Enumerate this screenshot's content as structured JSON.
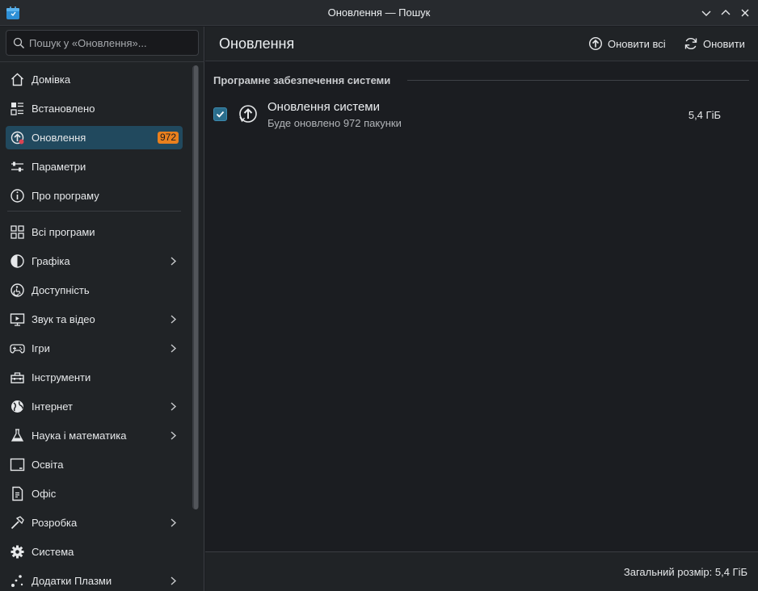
{
  "window": {
    "title": "Оновлення — Пошук",
    "controls": [
      "minimize-icon",
      "maximize-icon",
      "close-icon"
    ]
  },
  "search": {
    "placeholder": "Пошук у «Оновлення»..."
  },
  "sidebar": {
    "top_items": [
      {
        "label": "Домівка",
        "icon": "home-icon"
      },
      {
        "label": "Встановлено",
        "icon": "installed-icon"
      },
      {
        "label": "Оновлення",
        "icon": "updates-icon",
        "badge": "972",
        "active": true
      },
      {
        "label": "Параметри",
        "icon": "settings-sliders-icon"
      },
      {
        "label": "Про програму",
        "icon": "info-icon"
      }
    ],
    "categories": [
      {
        "label": "Всі програми",
        "icon": "grid-icon",
        "has_children": false
      },
      {
        "label": "Графіка",
        "icon": "graphics-icon",
        "has_children": true
      },
      {
        "label": "Доступність",
        "icon": "accessibility-icon",
        "has_children": false
      },
      {
        "label": "Звук та відео",
        "icon": "multimedia-icon",
        "has_children": true
      },
      {
        "label": "Ігри",
        "icon": "gamepad-icon",
        "has_children": true
      },
      {
        "label": "Інструменти",
        "icon": "toolbox-icon",
        "has_children": false
      },
      {
        "label": "Інтернет",
        "icon": "globe-icon",
        "has_children": true
      },
      {
        "label": "Наука і математика",
        "icon": "flask-icon",
        "has_children": true
      },
      {
        "label": "Освіта",
        "icon": "education-icon",
        "has_children": false
      },
      {
        "label": "Офіс",
        "icon": "office-icon",
        "has_children": false
      },
      {
        "label": "Розробка",
        "icon": "hammer-icon",
        "has_children": true
      },
      {
        "label": "Система",
        "icon": "gear-icon",
        "has_children": false
      },
      {
        "label": "Додатки Плазми",
        "icon": "plasma-addons-icon",
        "has_children": true
      }
    ]
  },
  "header": {
    "title": "Оновлення",
    "update_all_label": "Оновити всі",
    "refresh_label": "Оновити"
  },
  "main": {
    "section_title": "Програмне забезпечення системи",
    "update": {
      "name": "Оновлення системи",
      "description": "Буде оновлено 972 пакунки",
      "size": "5,4 ГіБ",
      "checked": true
    }
  },
  "footer": {
    "total_label": "Загальний розмір: 5,4 ГіБ"
  },
  "colors": {
    "accent": "#21495e",
    "badge": "#e9801d",
    "background": "#1b1d21",
    "panel": "#202326"
  }
}
